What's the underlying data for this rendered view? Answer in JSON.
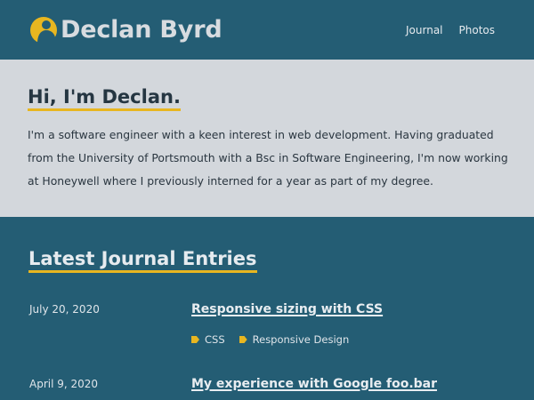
{
  "header": {
    "brand": "Declan Byrd",
    "logo_icon": "avatar-logo-icon",
    "nav": [
      "Journal",
      "Photos"
    ]
  },
  "intro": {
    "heading": "Hi, I'm Declan.",
    "body": "I'm a software engineer with a keen interest in web development. Having graduated from the University of Portsmouth with a Bsc in Software Engineering, I'm now working at Honeywell where I previously interned for a year as part of my degree."
  },
  "journal": {
    "title": "Latest Journal Entries",
    "entries": [
      {
        "date": "July 20, 2020",
        "title": "Responsive sizing with CSS",
        "tags": [
          "CSS",
          "Responsive Design"
        ]
      },
      {
        "date": "April 9, 2020",
        "title": "My experience with Google foo.bar"
      }
    ]
  },
  "colors": {
    "header_bg": "#245d74",
    "intro_bg": "#d3d7dc",
    "accent": "#e8b620"
  }
}
